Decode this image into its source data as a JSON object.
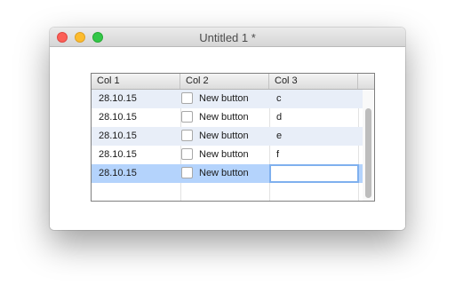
{
  "window": {
    "title": "Untitled 1 *"
  },
  "table": {
    "columns": [
      "Col 1",
      "Col 2",
      "Col 3"
    ],
    "rows": [
      {
        "col1": "28.10.15",
        "col2": "New button",
        "col3": "c"
      },
      {
        "col1": "28.10.15",
        "col2": "New button",
        "col3": "d"
      },
      {
        "col1": "28.10.15",
        "col2": "New button",
        "col3": "e"
      },
      {
        "col1": "28.10.15",
        "col2": "New button",
        "col3": "f"
      },
      {
        "col1": "28.10.15",
        "col2": "New button",
        "col3": ""
      }
    ],
    "selected_row": 5,
    "editing": {
      "row": 5,
      "column": "Col 3",
      "value": ""
    }
  },
  "colors": {
    "close": "#fc5f57",
    "minimize": "#fdbc2e",
    "zoom": "#33c748",
    "alt_row": "#e8eef8",
    "selected_row": "#b4d3fc",
    "focus_ring": "#7fb0ee"
  },
  "icons": [
    "close-icon",
    "minimize-icon",
    "zoom-icon",
    "checkbox-icon"
  ]
}
